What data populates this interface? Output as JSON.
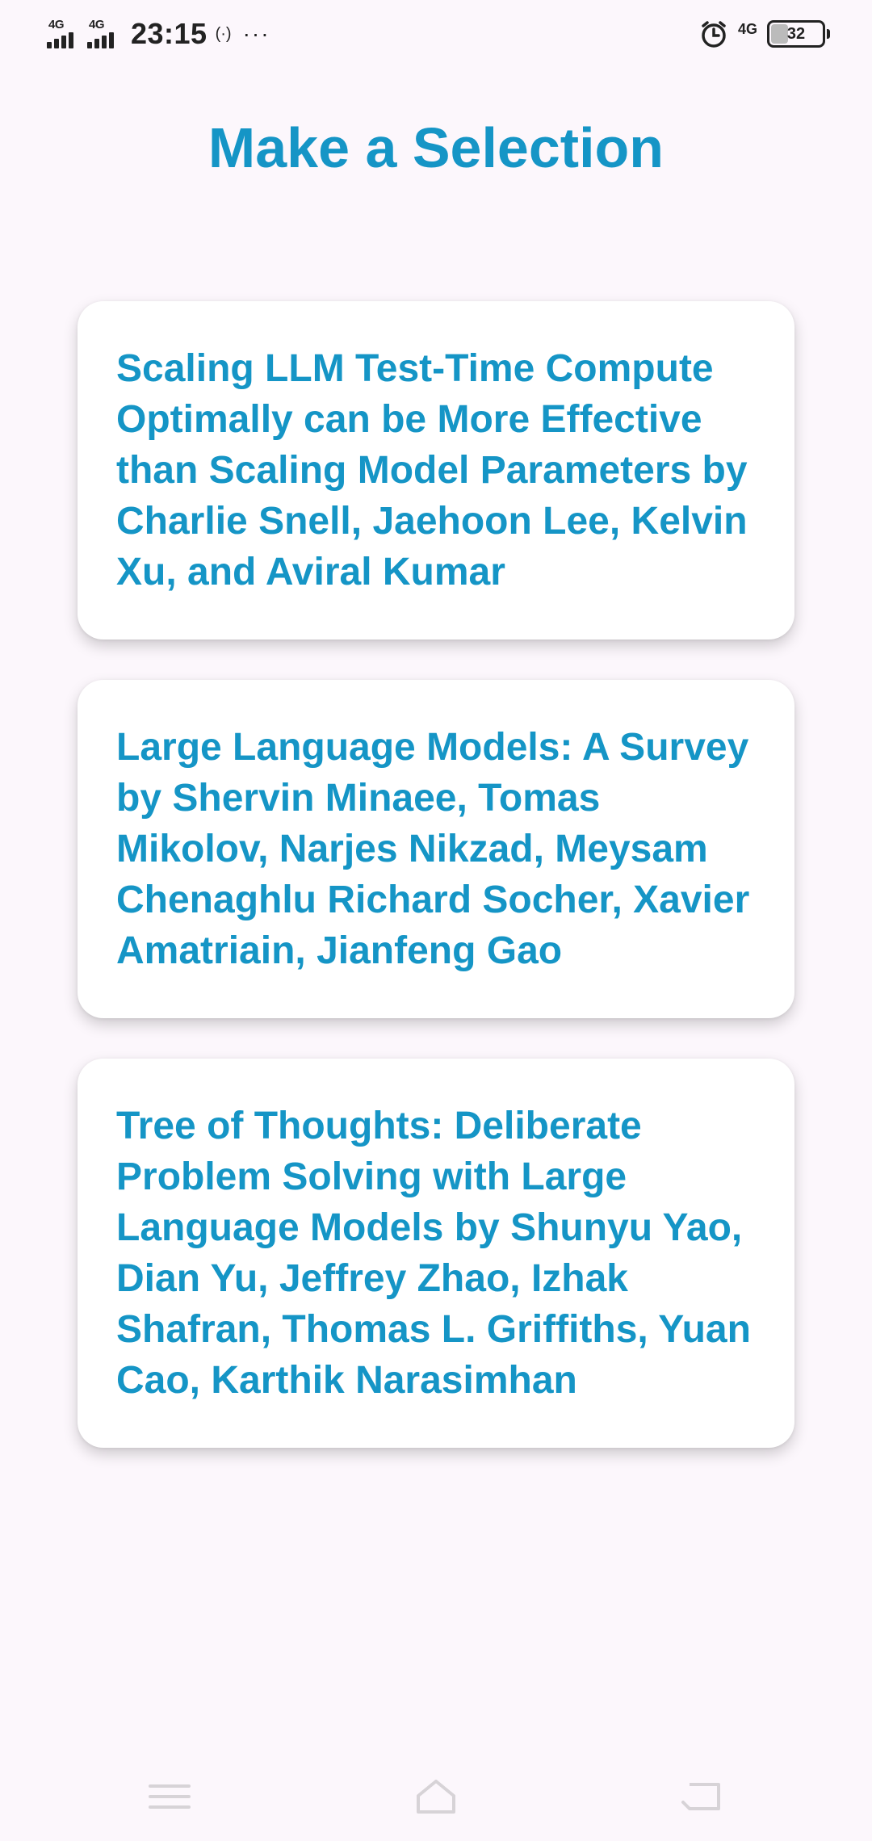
{
  "status_bar": {
    "sim1_network": "4G",
    "sim2_network": "4G",
    "time": "23:15",
    "hotspot_glyph": "(·)",
    "more": "···",
    "data_network": "4G",
    "battery_level": "32",
    "icons": [
      "signal-icon",
      "signal-icon",
      "hotspot-icon",
      "more-icon",
      "alarm-icon",
      "network-icon",
      "battery-icon"
    ]
  },
  "header": {
    "title": "Make a Selection"
  },
  "selections": [
    {
      "text": "Scaling LLM Test-Time Compute Optimally can be More Effective than Scaling Model Parameters by Charlie Snell, Jaehoon Lee, Kelvin Xu, and Aviral Kumar"
    },
    {
      "text": "Large Language Models: A Survey by Shervin Minaee, Tomas Mikolov, Narjes Nikzad, Meysam Chenaghlu Richard Socher, Xavier Amatriain, Jianfeng Gao"
    },
    {
      "text": "Tree of Thoughts: Deliberate Problem Solving with Large Language Models by Shunyu Yao, Dian Yu, Jeffrey Zhao, Izhak Shafran, Thomas L. Griffiths, Yuan Cao, Karthik Narasimhan"
    }
  ],
  "navigation": {
    "icons": [
      "menu-icon",
      "home-icon",
      "back-icon"
    ]
  },
  "colors": {
    "accent": "#1595c6",
    "background": "#fcf7fc",
    "card": "#ffffff"
  }
}
